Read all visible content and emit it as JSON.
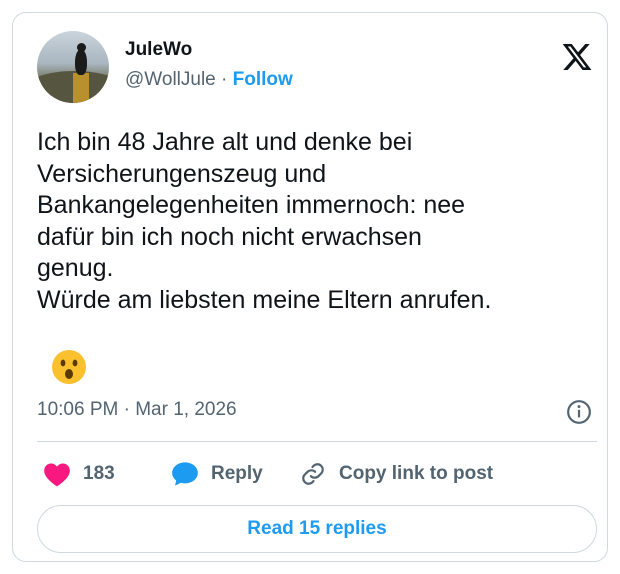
{
  "author": {
    "name": "JuleWo",
    "handle": "@WollJule",
    "separator": "·",
    "follow_label": "Follow"
  },
  "post": {
    "text": "Ich bin 48 Jahre alt und denke bei\nVersicherungenszeug und\nBankangelegenheiten immernoch: nee\ndafür bin ich noch nicht erwachsen\ngenug.\nWürde am liebsten meine Eltern anrufen.",
    "emoji": "astonished-face",
    "timestamp": "10:06 PM · Mar 1, 2026"
  },
  "actions": {
    "like_count": "183",
    "reply_label": "Reply",
    "copy_label": "Copy link to post",
    "read_replies_label": "Read 15 replies"
  },
  "colors": {
    "accent": "#1d9bf0",
    "heart": "#f91880",
    "muted": "#536471",
    "border": "#cfd9de"
  }
}
